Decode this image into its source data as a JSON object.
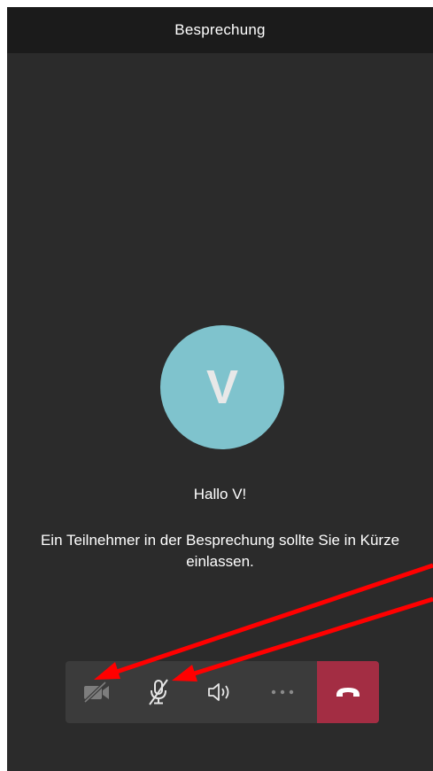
{
  "header": {
    "title": "Besprechung"
  },
  "participant": {
    "initial": "V",
    "avatar_color": "#7fc3cd"
  },
  "lobby": {
    "greeting": "Hallo V!",
    "message": "Ein Teilnehmer in der Besprechung sollte Sie in Kürze einlassen."
  },
  "call_controls": {
    "items": [
      {
        "icon": "video-off-icon",
        "state": "off"
      },
      {
        "icon": "mic-off-icon",
        "state": "muted"
      },
      {
        "icon": "speaker-icon",
        "state": "on"
      },
      {
        "icon": "more-icon"
      },
      {
        "icon": "hang-up-icon"
      }
    ],
    "hangup_color": "#a32d43",
    "bar_color": "#3b3b3b"
  },
  "annotation": {
    "arrow_color": "#ff0000"
  }
}
